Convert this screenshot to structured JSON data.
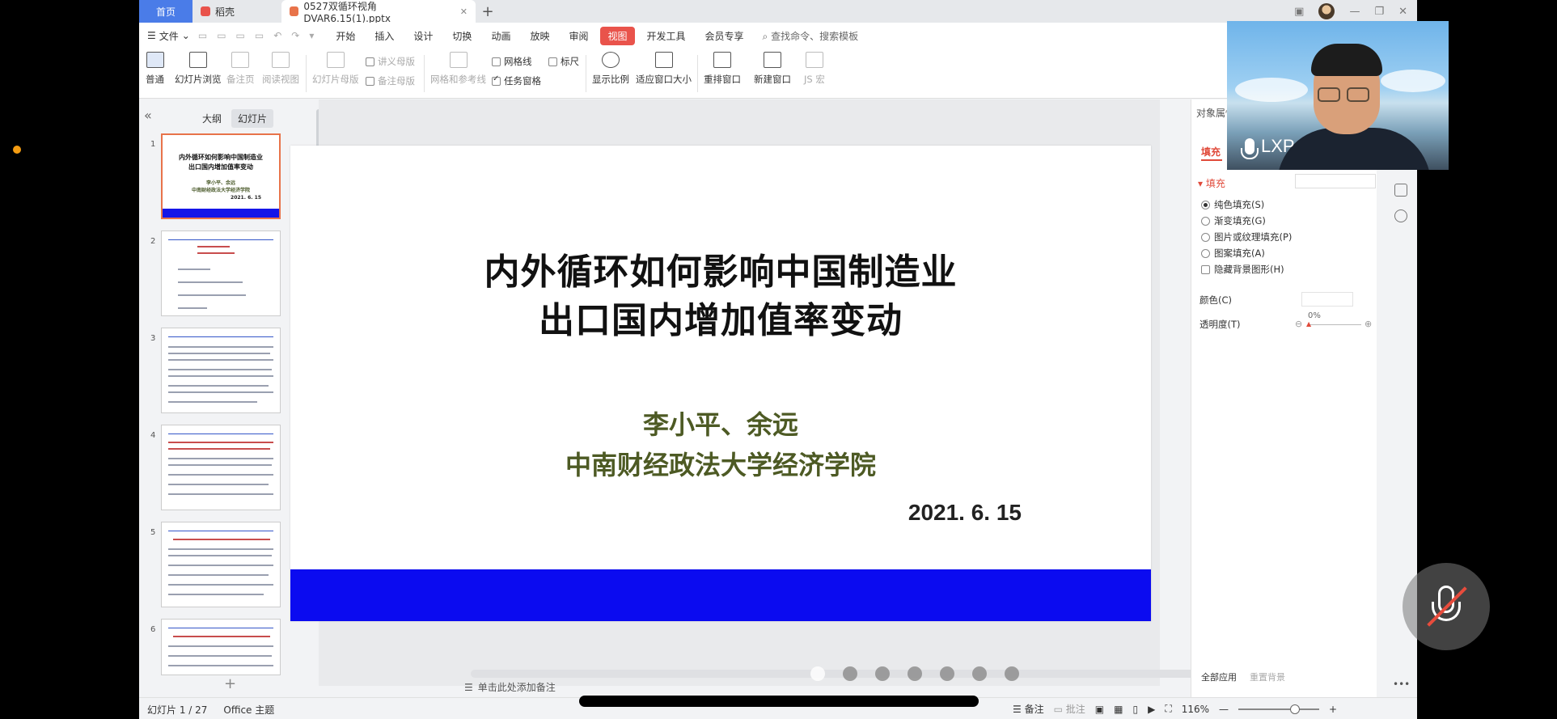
{
  "tabs": {
    "home": "首页",
    "docs": "稻壳",
    "file": "0527双循环视角DVAR6.15(1).pptx"
  },
  "menu": {
    "file": "文件",
    "items": [
      "开始",
      "插入",
      "设计",
      "切换",
      "动画",
      "放映",
      "审阅",
      "视图",
      "开发工具",
      "会员专享"
    ],
    "active": "视图",
    "search": "查找命令、搜索模板"
  },
  "ribbon": {
    "normal": "普通",
    "slide_browse": "幻灯片浏览",
    "notes_page": "备注页",
    "reading_view": "阅读视图",
    "slide_master": "幻灯片母版",
    "handout_master": "讲义母版",
    "notes_master": "备注母版",
    "grid_guides": "网格和参考线",
    "gridlines": "网格线",
    "ruler": "标尺",
    "task_pane": "任务窗格",
    "zoom": "显示比例",
    "fit_window": "适应窗口大小",
    "rearrange": "重排窗口",
    "new_window": "新建窗口",
    "js_macro": "JS 宏"
  },
  "left_panel": {
    "outline": "大纲",
    "slides": "幻灯片",
    "slide_numbers": [
      "1",
      "2",
      "3",
      "4",
      "5",
      "6"
    ]
  },
  "slide": {
    "title_line1": "内外循环如何影响中国制造业",
    "title_line2": "出口国内增加值率变动",
    "authors": "李小平、余远",
    "affiliation": "中南财经政法大学经济学院",
    "date": "2021. 6. 15"
  },
  "notes_placeholder": "单击此处添加备注",
  "right_panel": {
    "title": "对象属性",
    "fill_tab": "填充",
    "fill_section": "填充",
    "options": [
      "纯色填充(S)",
      "渐变填充(G)",
      "图片或纹理填充(P)",
      "图案填充(A)"
    ],
    "hide_bg": "隐藏背景图形(H)",
    "color": "颜色(C)",
    "transparency": "透明度(T)",
    "transparency_value": "0%",
    "apply_all": "全部应用",
    "reset_bg": "重置背景"
  },
  "status": {
    "slide_count": "幻灯片 1 / 27",
    "theme": "Office 主题",
    "notes": "备注",
    "comments": "批注",
    "zoom": "116%"
  },
  "video": {
    "name": "LXP"
  },
  "colors": {
    "accent_red": "#e9534b",
    "home_tab": "#4a7ce8",
    "slide_bar": "#0b0bf0",
    "author_green": "#4d5a24"
  }
}
